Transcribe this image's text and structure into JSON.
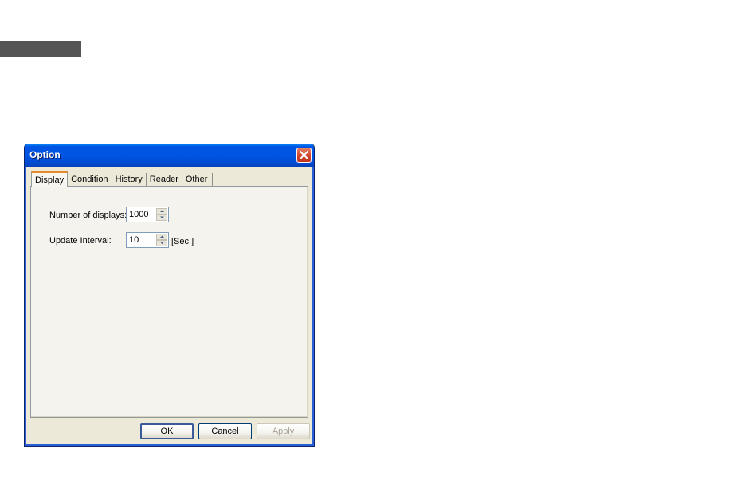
{
  "window": {
    "title": "Option"
  },
  "tabs": [
    {
      "label": "Display",
      "active": true
    },
    {
      "label": "Condition",
      "active": false
    },
    {
      "label": "History",
      "active": false
    },
    {
      "label": "Reader",
      "active": false
    },
    {
      "label": "Other",
      "active": false
    }
  ],
  "display": {
    "num_displays_label": "Number of displays:",
    "num_displays_value": "1000",
    "update_interval_label": "Update Interval:",
    "update_interval_value": "10",
    "update_interval_unit": "[Sec.]"
  },
  "buttons": {
    "ok": "OK",
    "cancel": "Cancel",
    "apply": "Apply"
  },
  "colors": {
    "titlebar": "#0055e5",
    "close_button": "#d1452c",
    "active_tab_accent": "#e68b2c",
    "dialog_face": "#ece9d8"
  },
  "icons": {
    "close": "close-icon",
    "spin_up": "arrow-up-icon",
    "spin_down": "arrow-down-icon"
  }
}
